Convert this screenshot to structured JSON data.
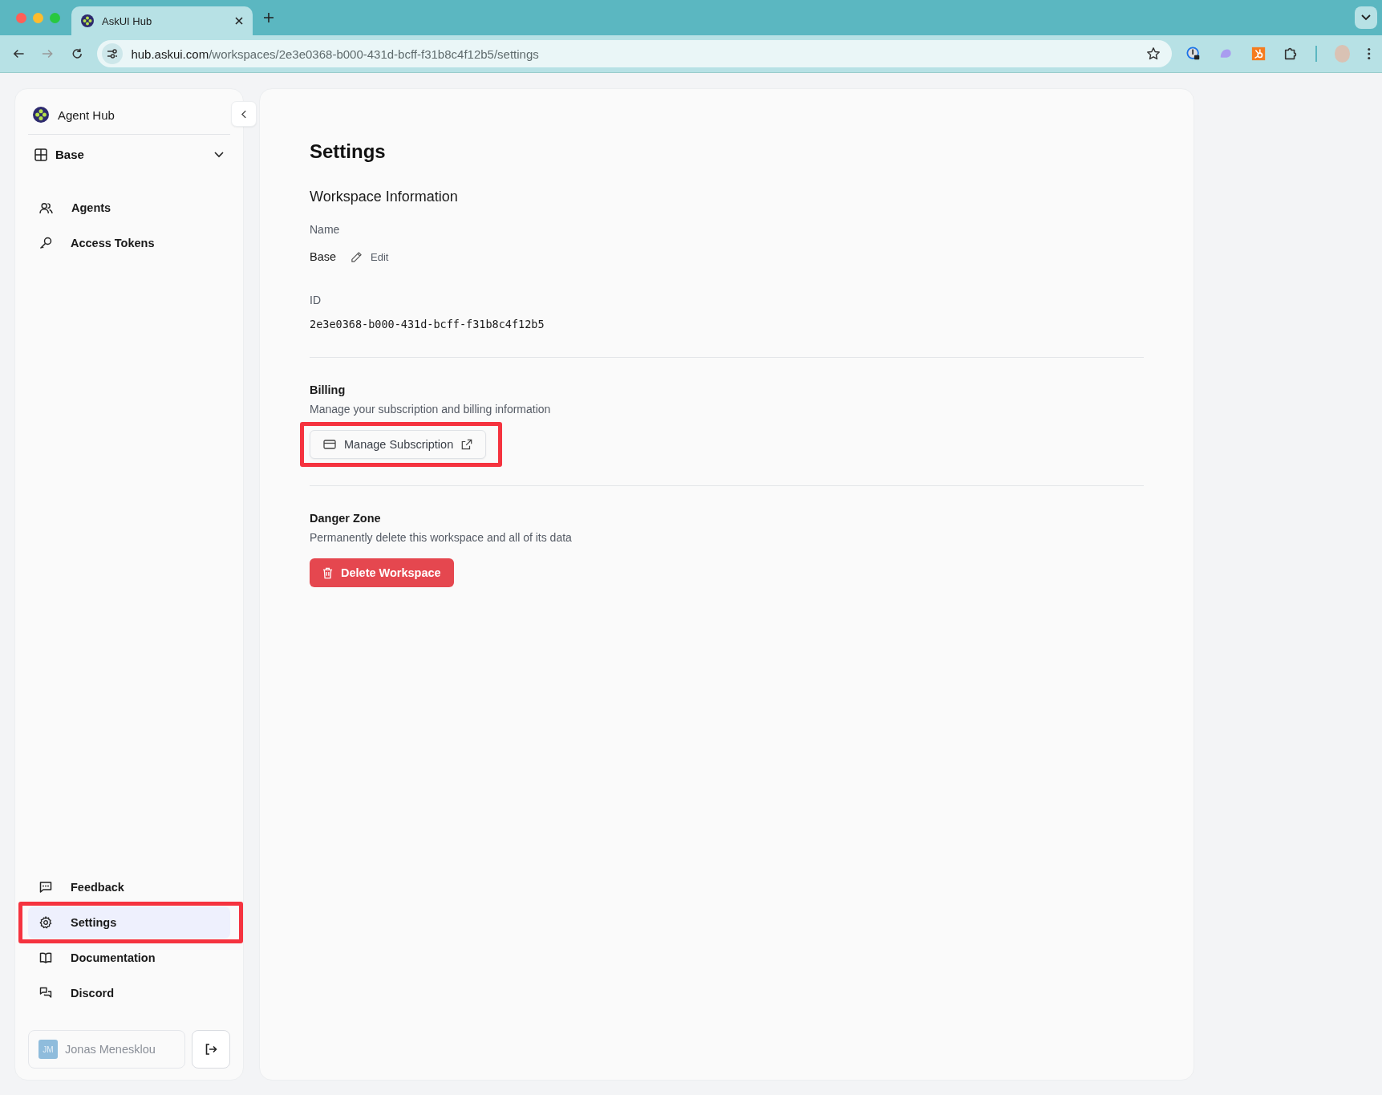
{
  "browser": {
    "tabs": [
      {
        "title": "AskUI Hub",
        "selected": true
      }
    ],
    "url": {
      "host": "hub.askui.com",
      "path": "/workspaces/2e3e0368-b000-431d-bcff-f31b8c4f12b5/settings"
    }
  },
  "sidebar": {
    "app_name": "Agent Hub",
    "workspace": "Base",
    "nav_items": [
      {
        "label": "Agents",
        "selected": false,
        "highlighted": false
      },
      {
        "label": "Access Tokens",
        "selected": false,
        "highlighted": false
      }
    ],
    "footer_items": [
      {
        "label": "Feedback",
        "selected": false,
        "highlighted": false
      },
      {
        "label": "Settings",
        "selected": true,
        "highlighted": true
      },
      {
        "label": "Documentation",
        "selected": false,
        "highlighted": false
      },
      {
        "label": "Discord",
        "selected": false,
        "highlighted": false
      }
    ],
    "user": {
      "initials": "JM",
      "name": "Jonas Menesklou"
    }
  },
  "main": {
    "title": "Settings",
    "section_title": "Workspace Information",
    "name_label": "Name",
    "name_value": "Base",
    "edit_label": "Edit",
    "id_label": "ID",
    "id_value": "2e3e0368-b000-431d-bcff-f31b8c4f12b5",
    "billing": {
      "title": "Billing",
      "description": "Manage your subscription and billing information",
      "button": "Manage Subscription",
      "highlighted": true
    },
    "danger": {
      "title": "Danger Zone",
      "description": "Permanently delete this workspace and all of its data",
      "button": "Delete Workspace"
    }
  }
}
